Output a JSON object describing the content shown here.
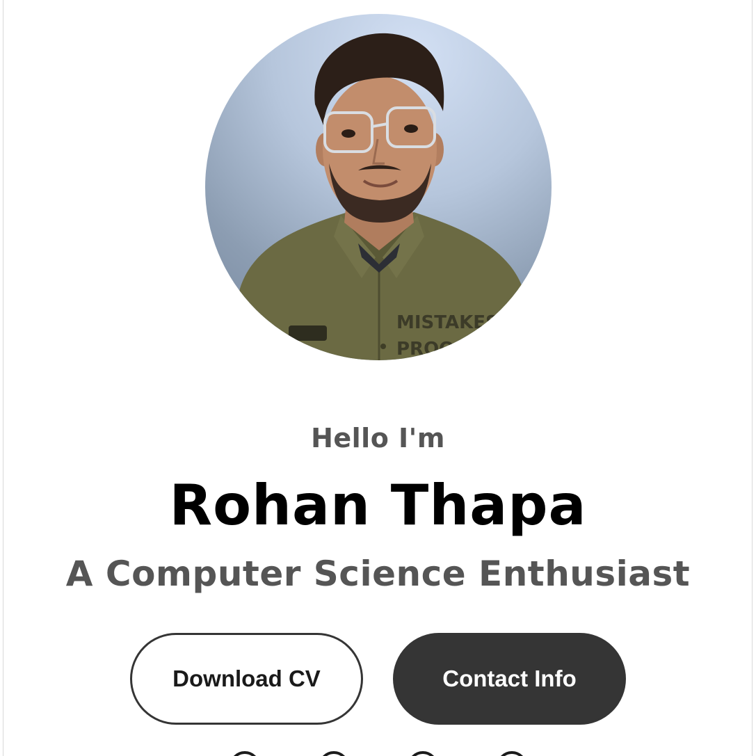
{
  "profile": {
    "photo_alt": "profile-photo",
    "greeting": "Hello I'm",
    "name": "Rohan Thapa",
    "subtitle": "A Computer Science Enthusiast",
    "shirt_text_line1": "MISTAKES",
    "shirt_text_line2": "PROO"
  },
  "actions": {
    "download_label": "Download CV",
    "contact_label": "Contact Info"
  },
  "socials": [
    {
      "icon": "linkedin-icon"
    },
    {
      "icon": "github-icon"
    },
    {
      "icon": "instagram-icon"
    },
    {
      "icon": "facebook-icon"
    }
  ],
  "colors": {
    "text_primary": "#000000",
    "text_secondary": "#555555",
    "button_dark": "#353535",
    "page_bg": "#ffffff"
  }
}
